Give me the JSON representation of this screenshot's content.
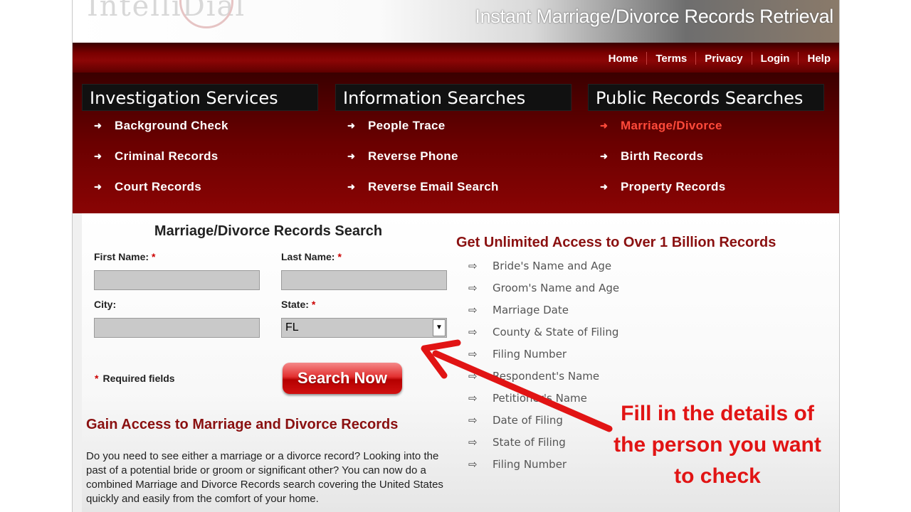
{
  "banner": {
    "title": "Instant Marriage/Divorce Records Retrieval"
  },
  "nav": {
    "links": [
      "Home",
      "Terms",
      "Privacy",
      "Login",
      "Help"
    ]
  },
  "services": [
    {
      "header": "Investigation Services",
      "items": [
        "Background Check",
        "Criminal Records",
        "Court Records"
      ]
    },
    {
      "header": "Information Searches",
      "items": [
        "People Trace",
        "Reverse Phone",
        "Reverse Email Search"
      ]
    },
    {
      "header": "Public Records Searches",
      "items": [
        "Marriage/Divorce",
        "Birth Records",
        "Property Records"
      ],
      "active_index": 0
    }
  ],
  "form": {
    "title": "Marriage/Divorce Records Search",
    "first_name_label": "First Name:",
    "last_name_label": "Last Name:",
    "city_label": "City:",
    "state_label": "State:",
    "required_mark": "*",
    "first_name_value": "",
    "last_name_value": "",
    "city_value": "",
    "state_value": "FL",
    "required_note": "Required fields",
    "search_button": "Search Now"
  },
  "gain": {
    "title": "Gain Access to Marriage and Divorce Records",
    "body": "Do you need to see either a marriage or a divorce record? Looking into the past of a potential bride or groom or significant other? You can now do a combined Marriage and Divorce Records search covering the United States quickly and easily from the comfort of your home."
  },
  "access": {
    "title": "Get Unlimited Access to Over 1 Billion Records",
    "items": [
      "Bride's Name and Age",
      "Groom's Name and Age",
      "Marriage Date",
      "County & State of Filing",
      "Filing Number",
      "Respondent's Name",
      "Petitioner's Name",
      "Date of Filing",
      "State of Filing",
      "Filing Number"
    ]
  },
  "callout": {
    "text": "Fill in the details of the person you want to check"
  },
  "colors": {
    "accent_dark": "#7a0000",
    "heading_red": "#8a1010",
    "callout_red": "#e11414",
    "active_link": "#ff4a3a"
  },
  "icons": {
    "list_bullet": "arrow-right-icon",
    "access_bullet": "outline-arrow-right-icon",
    "select_toggle": "chevron-down-icon"
  }
}
